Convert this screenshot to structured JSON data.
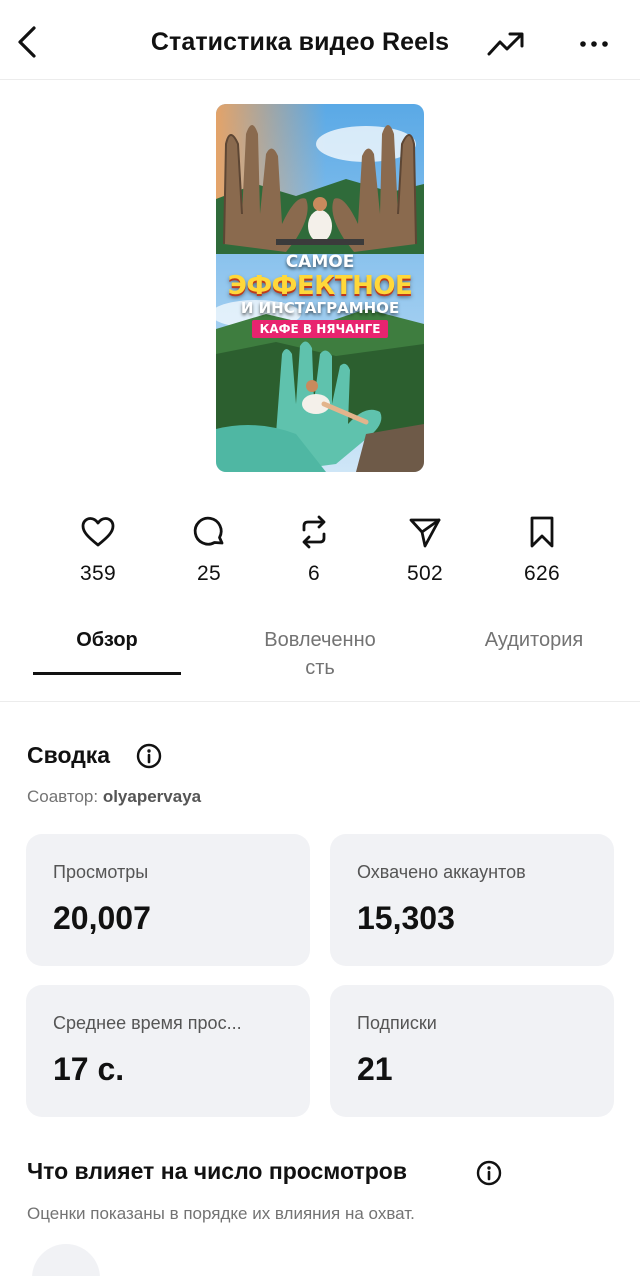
{
  "header": {
    "title": "Статистика видео Reels",
    "back_icon": "chevron-left-icon",
    "trend_icon": "trending-up-icon",
    "more_icon": "more-horizontal-icon"
  },
  "thumbnail": {
    "line1": "САМОЕ",
    "line2": "ЭФФЕКТНОЕ",
    "line3": "И ИНСТАГРАМНОЕ",
    "line4": "КАФЕ В НЯЧАНГЕ"
  },
  "stats": [
    {
      "icon": "heart-icon",
      "value": "359"
    },
    {
      "icon": "comment-icon",
      "value": "25"
    },
    {
      "icon": "repost-icon",
      "value": "6"
    },
    {
      "icon": "share-icon",
      "value": "502"
    },
    {
      "icon": "bookmark-icon",
      "value": "626"
    }
  ],
  "tabs": [
    {
      "label": "Обзор",
      "active": true
    },
    {
      "label": "Вовлеченно сть",
      "line1": "Вовлеченно",
      "line2": "сть",
      "active": false
    },
    {
      "label": "Аудитория",
      "active": false
    }
  ],
  "summary": {
    "title": "Сводка",
    "coauthor_label": "Соавтор:",
    "coauthor_name": "olyapervaya",
    "cards": [
      {
        "label": "Просмотры",
        "value": "20,007"
      },
      {
        "label": "Охвачено аккаунтов",
        "value": "15,303"
      },
      {
        "label": "Среднее время прос...",
        "value": "17 с."
      },
      {
        "label": "Подписки",
        "value": "21"
      }
    ]
  },
  "influence": {
    "title": "Что влияет на число просмотров",
    "subtitle": "Оценки показаны в порядке их влияния на охват."
  },
  "colors": {
    "text": "#111111",
    "secondary": "#737373",
    "card_bg": "#f1f2f5",
    "divider": "#ececec"
  }
}
